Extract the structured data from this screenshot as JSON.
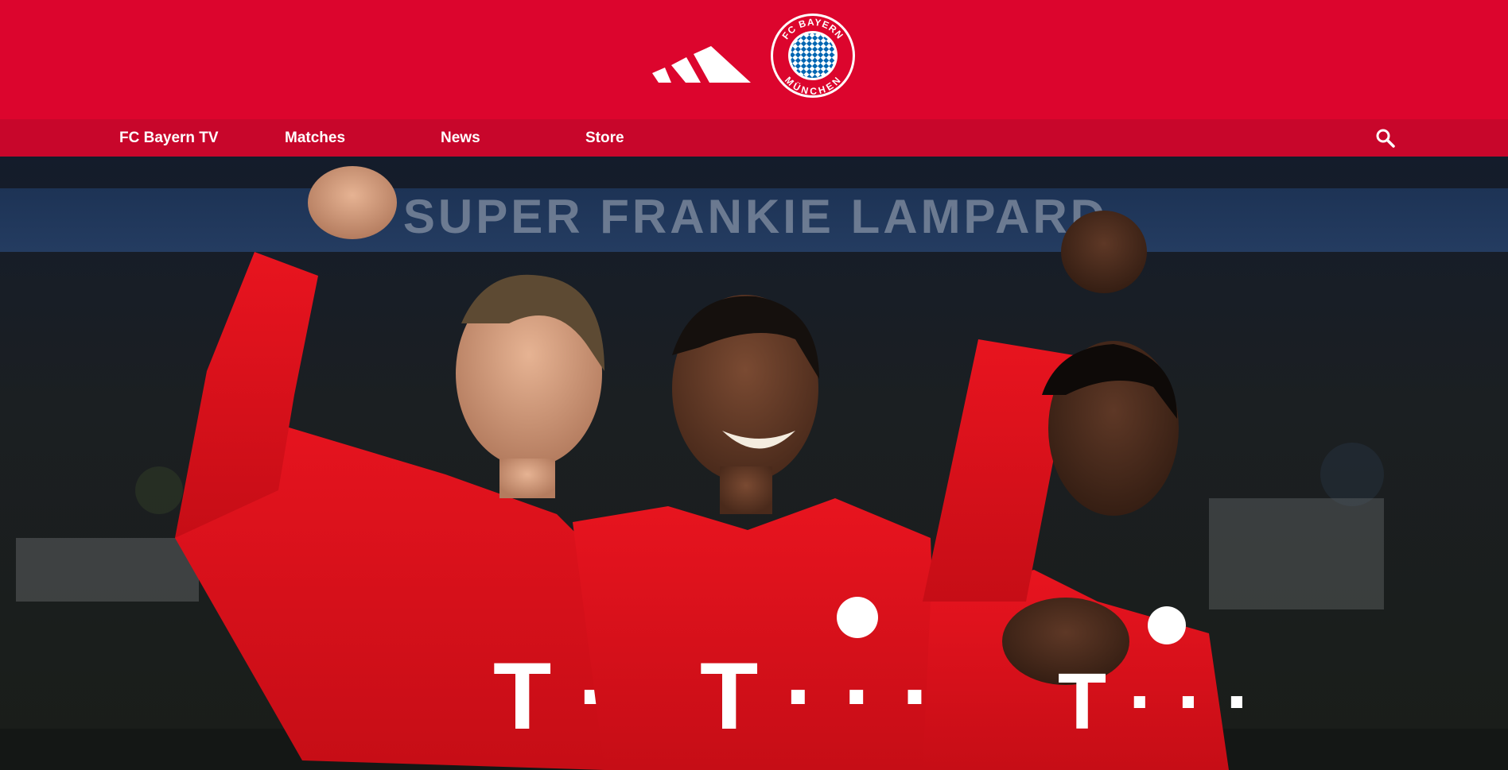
{
  "header": {
    "sponsor_logo_icon": "adidas-three-stripes-icon",
    "crest_icon": "fc-bayern-muenchen-crest",
    "crest_text": "FC BAYERN MÜNCHEN",
    "background_color": "#dc052d"
  },
  "nav": {
    "background_color": "#c8062b",
    "items": [
      {
        "label": "FC Bayern TV"
      },
      {
        "label": "Matches"
      },
      {
        "label": "News"
      },
      {
        "label": "Store"
      }
    ],
    "search_icon": "search-icon"
  },
  "hero": {
    "stadium_banner_text": "SUPER FRANKIE LAMPARD",
    "jersey_sponsor_mark": "T · · ·",
    "jersey_color": "#e1161f"
  }
}
